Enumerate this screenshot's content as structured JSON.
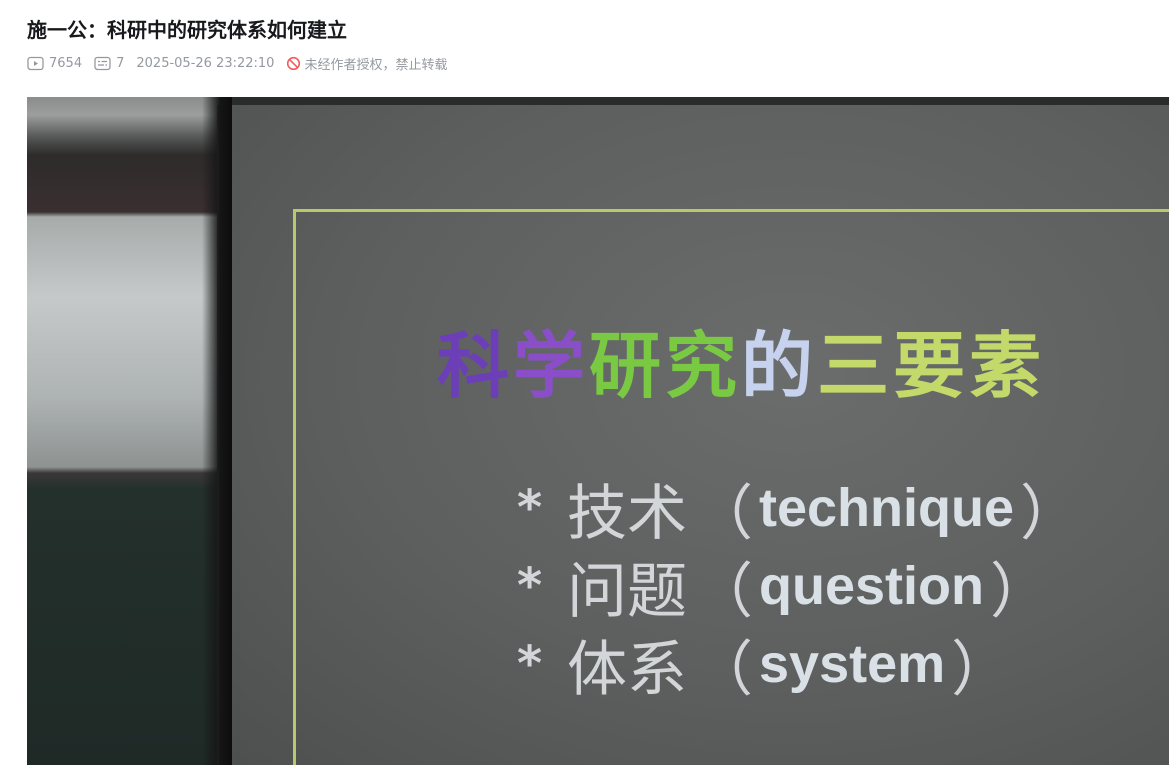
{
  "video": {
    "title": "施一公：科研中的研究体系如何建立",
    "views": "7654",
    "danmaku": "7",
    "datetime": "2025-05-26 23:22:10",
    "copyright_notice": "未经作者授权，禁止转载"
  },
  "slide": {
    "title_parts": [
      "科",
      "学",
      "研究",
      "的",
      "三要素"
    ],
    "bullets": [
      {
        "star": "*",
        "zh": "技术",
        "open": "（",
        "en": "technique",
        "close": "）"
      },
      {
        "star": "*",
        "zh": "问题",
        "open": "（",
        "en": "question",
        "close": "）"
      },
      {
        "star": "*",
        "zh": "体系",
        "open": "（",
        "en": "system",
        "close": "）"
      }
    ]
  },
  "colors": {
    "meta_text": "#9499a0",
    "title_text": "#18191c",
    "warning": "#f25d5d",
    "slide_border": "#b9c868"
  },
  "icons": [
    "play-count-icon",
    "danmaku-icon",
    "no-repost-icon"
  ]
}
